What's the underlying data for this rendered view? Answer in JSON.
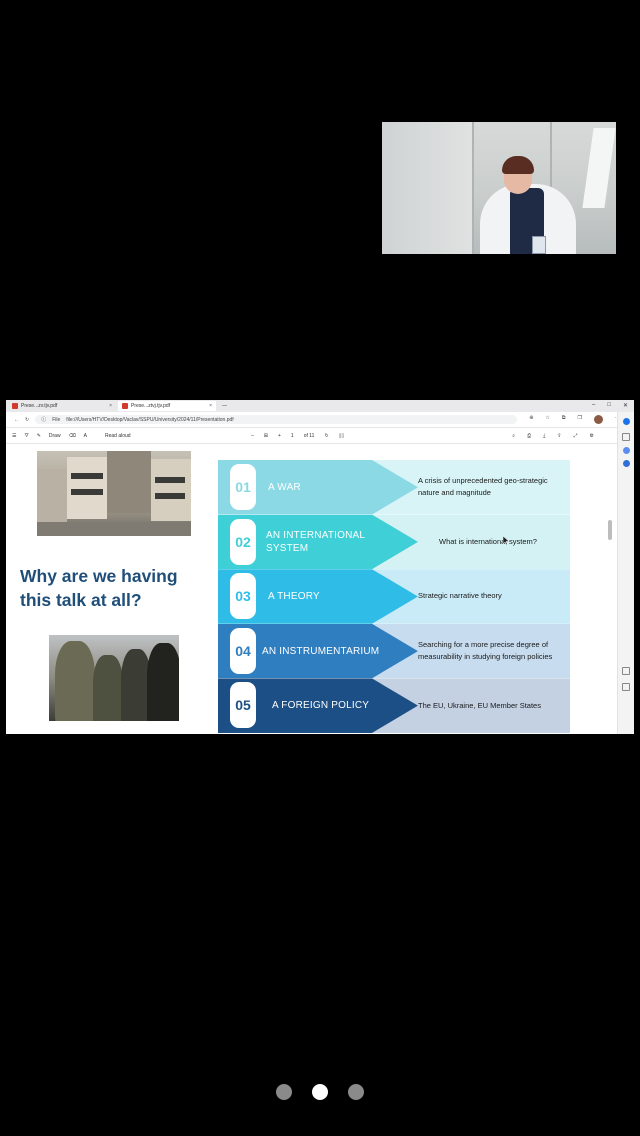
{
  "browser": {
    "tabs": [
      {
        "label": "Prese...zv.tjv.pdf",
        "active": false
      },
      {
        "label": "Prese...ztvj.tjv.pdf",
        "active": true
      }
    ],
    "tab_new": "—",
    "controls": [
      "–",
      "□",
      "✕"
    ],
    "address": {
      "prefix": "File",
      "url": "file:///Users/HTV/Desktop/Vaclav/SSPU/University/2024/11/Presentation.pdf"
    },
    "pdf_toolbar": {
      "draw_label": "Draw",
      "read_aloud_label": "Read aloud",
      "minus": "–",
      "plus": "+",
      "page": "of 11",
      "page_num": "1"
    }
  },
  "slide": {
    "title": "Why are we having this talk at all?",
    "rows": [
      {
        "num": "01",
        "label": "A WAR",
        "desc": "A crisis of unprecedented geo-strategic nature and magnitude",
        "band": "#8ad9e5",
        "desc_bg": "#d8f4f7",
        "num_color": "#8ad9e5"
      },
      {
        "num": "02",
        "label": "AN INTERNATIONAL SYSTEM",
        "desc": "What is international system?",
        "band": "#3fcfd6",
        "desc_bg": "#d4f2f4",
        "num_color": "#3fcfd6"
      },
      {
        "num": "03",
        "label": "A THEORY",
        "desc": "Strategic narrative theory",
        "band": "#2fbde8",
        "desc_bg": "#c9ebf8",
        "num_color": "#2fbde8"
      },
      {
        "num": "04",
        "label": "AN INSTRUMENTARIUM",
        "desc": "Searching for a more precise degree of measurability in studying foreign policies",
        "band": "#2f7ec0",
        "desc_bg": "#c7dcef",
        "num_color": "#2f7ec0"
      },
      {
        "num": "05",
        "label": "A FOREIGN POLICY",
        "desc": "The EU, Ukraine, EU Member States",
        "band": "#1b4f86",
        "desc_bg": "#c3d1e2",
        "num_color": "#1b4f86"
      }
    ]
  },
  "pager": {
    "count": 3,
    "active": 2
  }
}
